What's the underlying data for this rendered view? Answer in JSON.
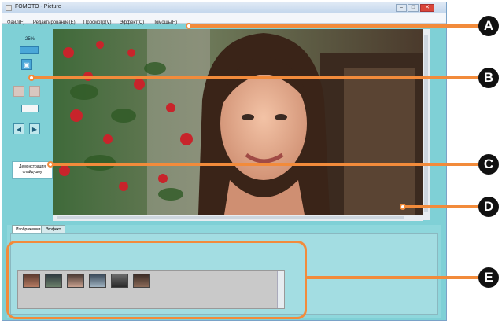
{
  "window": {
    "title": "FOMOTO - Picture",
    "minimize_label": "–",
    "maximize_label": "□",
    "close_label": "✕"
  },
  "menu": [
    "Файл(F)",
    "Редактирование(E)",
    "Просмотр(V)",
    "Эффект(C)",
    "Помощь(H)"
  ],
  "left_panel": {
    "zoom_label": "25%",
    "slideshow_label": "Демонстрация слайд-шоу"
  },
  "tabs": [
    {
      "label": "Изображения"
    },
    {
      "label": "Эффект"
    }
  ],
  "callouts": [
    "A",
    "B",
    "C",
    "D",
    "E"
  ],
  "colors": {
    "accent": "#f28b3b",
    "panel": "#7fd0d6",
    "badge": "#111111"
  }
}
